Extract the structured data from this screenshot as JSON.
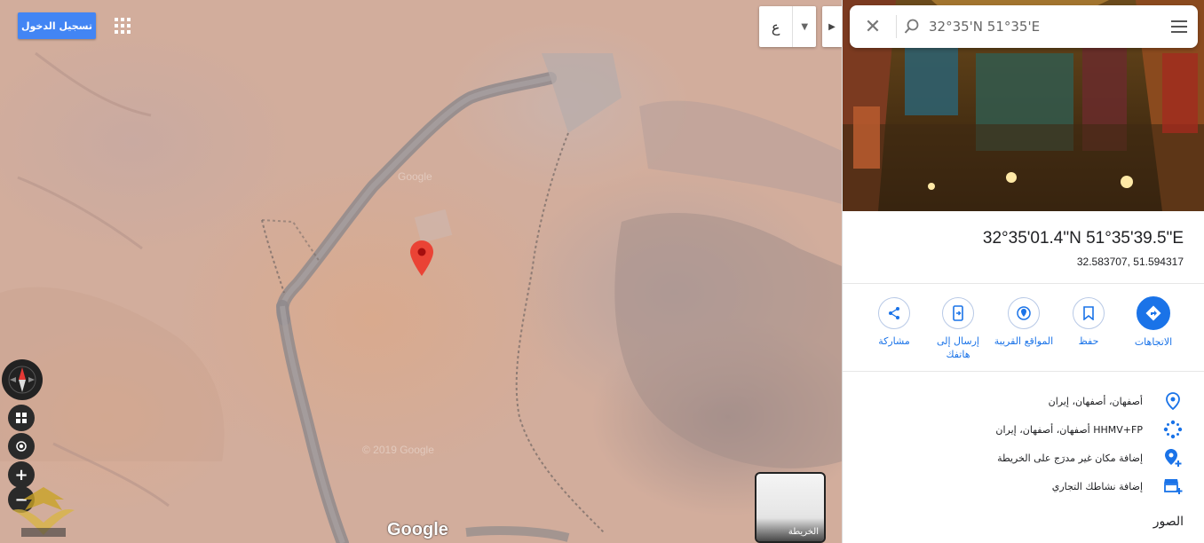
{
  "map": {
    "signin_label": "تسجيل الدخول",
    "language_letter": "ع",
    "google_logo": "Google",
    "thumbnail_label": "الخريطة",
    "tile_watermarks": [
      "© 2019 Google",
      "Google",
      "© 2019 Google"
    ]
  },
  "panel": {
    "search_query": "32°35'N 51°35'E",
    "coordinates_dms": "32°35'01.4\"N 51°35'39.5\"E",
    "coordinates_decimal": "32.583707, 51.594317",
    "actions": [
      {
        "label": "الاتجاهات",
        "icon": "directions-icon"
      },
      {
        "label": "حفظ",
        "icon": "bookmark-icon"
      },
      {
        "label": "المواقع القريبة",
        "icon": "nearby-icon"
      },
      {
        "label": "إرسال إلى هاتفك",
        "icon": "send-to-phone-icon"
      },
      {
        "label": "مشاركة",
        "icon": "share-icon"
      }
    ],
    "info_rows": [
      {
        "text": "أصفهان، أصفهان، إيران",
        "icon": "location-pin-icon"
      },
      {
        "text": "HHMV+FP أصفهان، أصفهان، إيران",
        "icon": "plus-code-icon"
      },
      {
        "text": "إضافة مكان غير مدرَج على الخريطة",
        "icon": "add-place-icon"
      },
      {
        "text": "إضافة نشاطك التجاري",
        "icon": "add-business-icon"
      }
    ],
    "photos_heading": "الصور"
  },
  "colors": {
    "accent": "#1a73e8",
    "signin_bg": "#4285f4",
    "pin": "#ea4335"
  }
}
